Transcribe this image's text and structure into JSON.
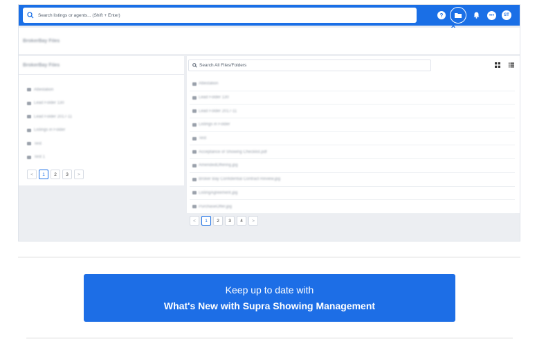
{
  "app": {
    "search_placeholder": "Search listings or agents... (Shift + Enter)",
    "avatar_initials": "ST",
    "help_glyph": "?",
    "chat_glyph": "•••"
  },
  "page": {
    "title": "BrokerBay Files"
  },
  "left_panel": {
    "header": "BrokerBay Files",
    "folders": [
      {
        "label": "Attestation"
      },
      {
        "label": "Lead Folder 130"
      },
      {
        "label": "Lead Folder 2017-11"
      },
      {
        "label": "Listings in Folder"
      },
      {
        "label": "Test"
      },
      {
        "label": "Test 1"
      }
    ],
    "pagination": {
      "prev": "<",
      "pages": [
        "1",
        "2",
        "3"
      ],
      "current": "1",
      "next": ">"
    }
  },
  "right_panel": {
    "search_placeholder": "Search All Files/Folders",
    "rows": [
      {
        "label": "Attestation"
      },
      {
        "label": "Lead Folder 130"
      },
      {
        "label": "Lead Folder 2017-11"
      },
      {
        "label": "Listings in Folder"
      },
      {
        "label": "Test"
      },
      {
        "label": "Acceptance of Showing Checklist.pdf"
      },
      {
        "label": "AmendedOffering.jpg"
      },
      {
        "label": "Broker Bay Confidential Contract Review.jpg"
      },
      {
        "label": "ListingAgreement.jpg"
      },
      {
        "label": "PurchaseOffer.jpg"
      }
    ],
    "pagination": {
      "prev": "<",
      "pages": [
        "1",
        "2",
        "3",
        "4"
      ],
      "current": "1",
      "next": ">"
    }
  },
  "cta": {
    "line1": "Keep up to date with",
    "line2": "What's New with Supra Showing Management"
  },
  "colors": {
    "brand_blue": "#1a6fe6",
    "cta_blue": "#1d6ee6"
  }
}
